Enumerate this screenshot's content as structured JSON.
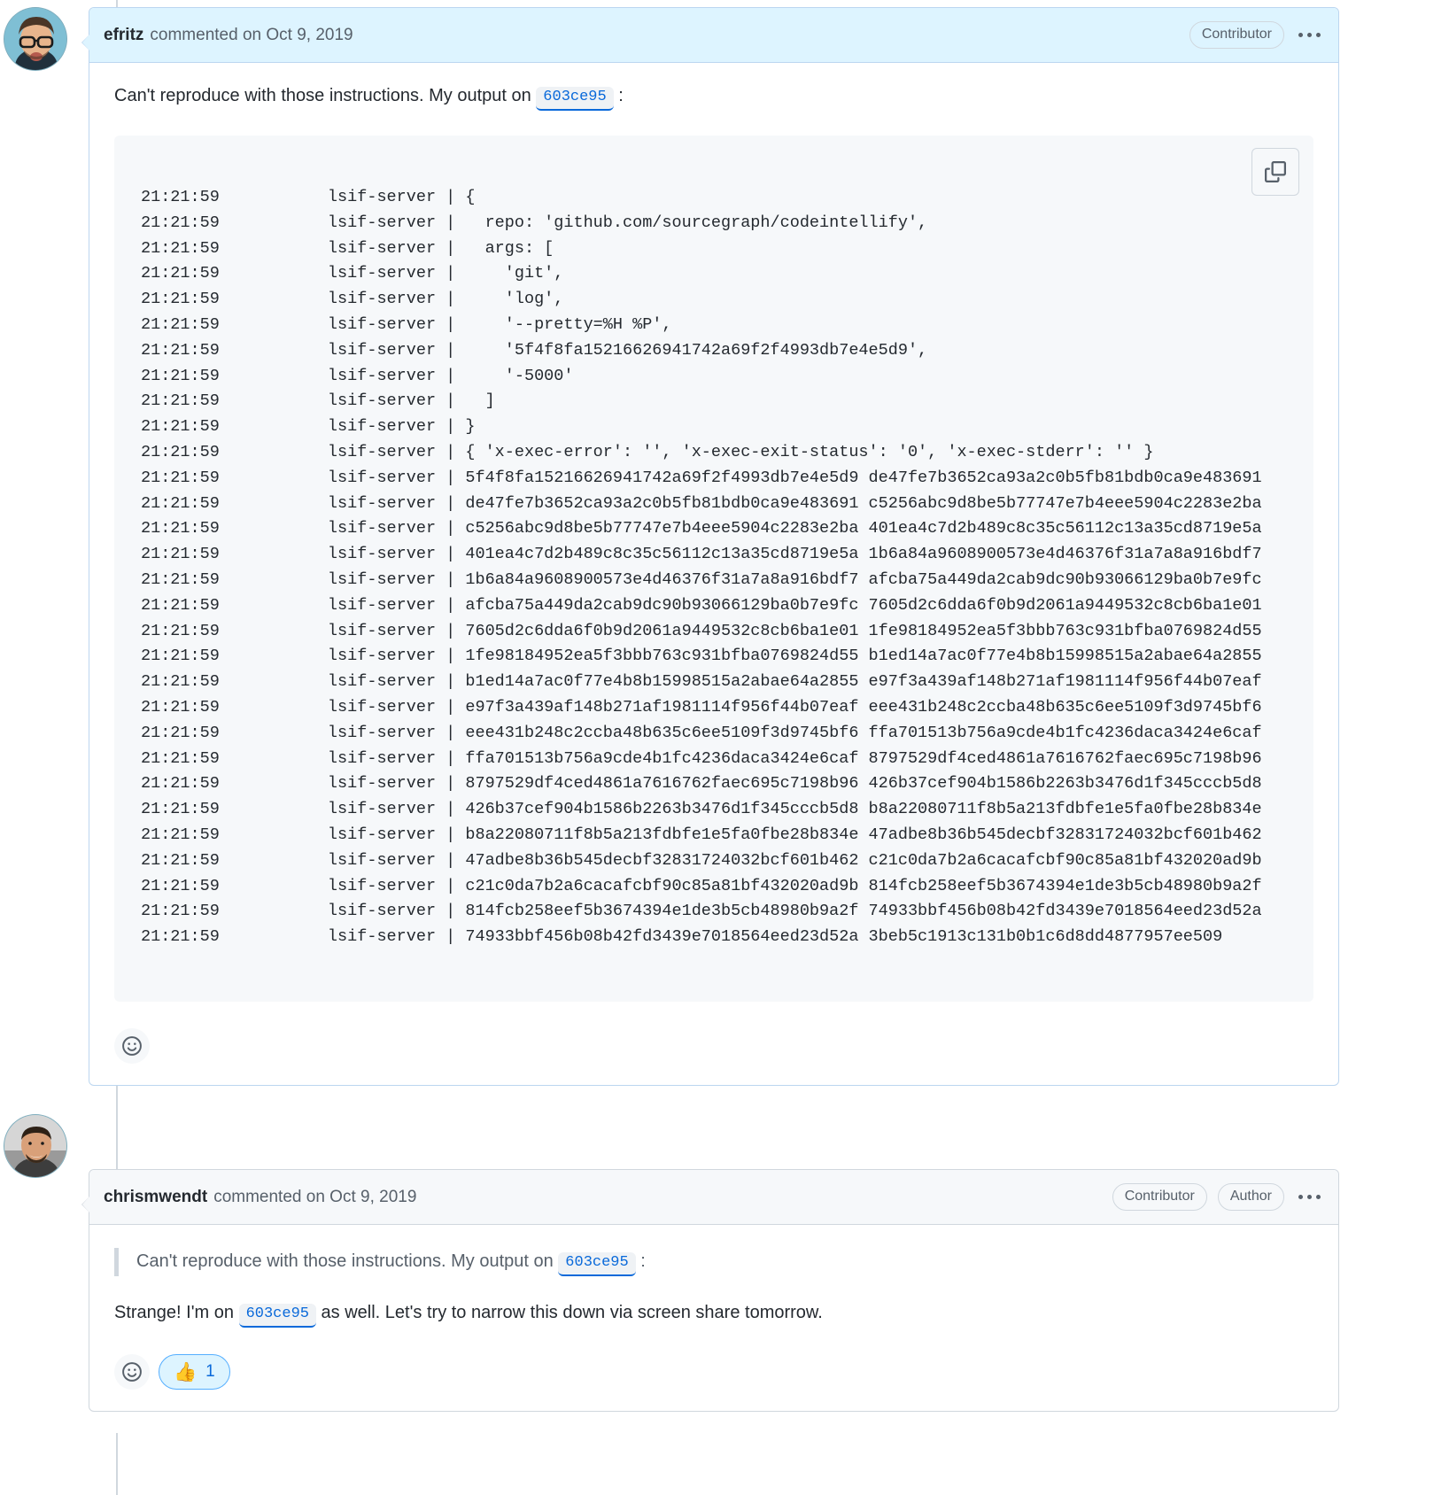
{
  "comments": [
    {
      "author": "efritz",
      "commented_on": "commented on Oct 9, 2019",
      "badges": [
        "Contributor"
      ],
      "body_prefix": "Can't reproduce with those instructions. My output on",
      "body_commit": "603ce95",
      "body_suffix": ":",
      "code_lines": [
        "21:21:59           lsif-server | {",
        "21:21:59           lsif-server |   repo: 'github.com/sourcegraph/codeintellify',",
        "21:21:59           lsif-server |   args: [",
        "21:21:59           lsif-server |     'git',",
        "21:21:59           lsif-server |     'log',",
        "21:21:59           lsif-server |     '--pretty=%H %P',",
        "21:21:59           lsif-server |     '5f4f8fa15216626941742a69f2f4993db7e4e5d9',",
        "21:21:59           lsif-server |     '-5000'",
        "21:21:59           lsif-server |   ]",
        "21:21:59           lsif-server | }",
        "21:21:59           lsif-server | { 'x-exec-error': '', 'x-exec-exit-status': '0', 'x-exec-stderr': '' }",
        "21:21:59           lsif-server | 5f4f8fa15216626941742a69f2f4993db7e4e5d9 de47fe7b3652ca93a2c0b5fb81bdb0ca9e483691",
        "21:21:59           lsif-server | de47fe7b3652ca93a2c0b5fb81bdb0ca9e483691 c5256abc9d8be5b77747e7b4eee5904c2283e2ba",
        "21:21:59           lsif-server | c5256abc9d8be5b77747e7b4eee5904c2283e2ba 401ea4c7d2b489c8c35c56112c13a35cd8719e5a",
        "21:21:59           lsif-server | 401ea4c7d2b489c8c35c56112c13a35cd8719e5a 1b6a84a9608900573e4d46376f31a7a8a916bdf7",
        "21:21:59           lsif-server | 1b6a84a9608900573e4d46376f31a7a8a916bdf7 afcba75a449da2cab9dc90b93066129ba0b7e9fc",
        "21:21:59           lsif-server | afcba75a449da2cab9dc90b93066129ba0b7e9fc 7605d2c6dda6f0b9d2061a9449532c8cb6ba1e01",
        "21:21:59           lsif-server | 7605d2c6dda6f0b9d2061a9449532c8cb6ba1e01 1fe98184952ea5f3bbb763c931bfba0769824d55",
        "21:21:59           lsif-server | 1fe98184952ea5f3bbb763c931bfba0769824d55 b1ed14a7ac0f77e4b8b15998515a2abae64a2855",
        "21:21:59           lsif-server | b1ed14a7ac0f77e4b8b15998515a2abae64a2855 e97f3a439af148b271af1981114f956f44b07eaf",
        "21:21:59           lsif-server | e97f3a439af148b271af1981114f956f44b07eaf eee431b248c2ccba48b635c6ee5109f3d9745bf6",
        "21:21:59           lsif-server | eee431b248c2ccba48b635c6ee5109f3d9745bf6 ffa701513b756a9cde4b1fc4236daca3424e6caf",
        "21:21:59           lsif-server | ffa701513b756a9cde4b1fc4236daca3424e6caf 8797529df4ced4861a7616762faec695c7198b96",
        "21:21:59           lsif-server | 8797529df4ced4861a7616762faec695c7198b96 426b37cef904b1586b2263b3476d1f345cccb5d8",
        "21:21:59           lsif-server | 426b37cef904b1586b2263b3476d1f345cccb5d8 b8a22080711f8b5a213fdbfe1e5fa0fbe28b834e",
        "21:21:59           lsif-server | b8a22080711f8b5a213fdbfe1e5fa0fbe28b834e 47adbe8b36b545decbf32831724032bcf601b462",
        "21:21:59           lsif-server | 47adbe8b36b545decbf32831724032bcf601b462 c21c0da7b2a6cacafcbf90c85a81bf432020ad9b",
        "21:21:59           lsif-server | c21c0da7b2a6cacafcbf90c85a81bf432020ad9b 814fcb258eef5b3674394e1de3b5cb48980b9a2f",
        "21:21:59           lsif-server | 814fcb258eef5b3674394e1de3b5cb48980b9a2f 74933bbf456b08b42fd3439e7018564eed23d52a",
        "21:21:59           lsif-server | 74933bbf456b08b42fd3439e7018564eed23d52a 3beb5c1913c131b0b1c6d8dd4877957ee509"
      ],
      "copy_icon": "copy-icon",
      "reaction_smiley": "smiley-icon"
    },
    {
      "author": "chrismwendt",
      "commented_on": "commented on Oct 9, 2019",
      "badges": [
        "Contributor",
        "Author"
      ],
      "quote_prefix": "Can't reproduce with those instructions. My output on",
      "quote_commit": "603ce95",
      "quote_suffix": ":",
      "reply_prefix": "Strange! I'm on",
      "reply_commit": "603ce95",
      "reply_suffix": "as well. Let's try to narrow this down via screen share tomorrow.",
      "reaction_smiley": "smiley-icon",
      "reaction_emoji": "👍",
      "reaction_count": "1"
    }
  ],
  "colors": {
    "accent": "#0969da",
    "header_highlight": "#ddf4ff",
    "header_plain": "#f6f8fa",
    "border": "#d0d7de",
    "reaction_border": "#54aeff"
  }
}
